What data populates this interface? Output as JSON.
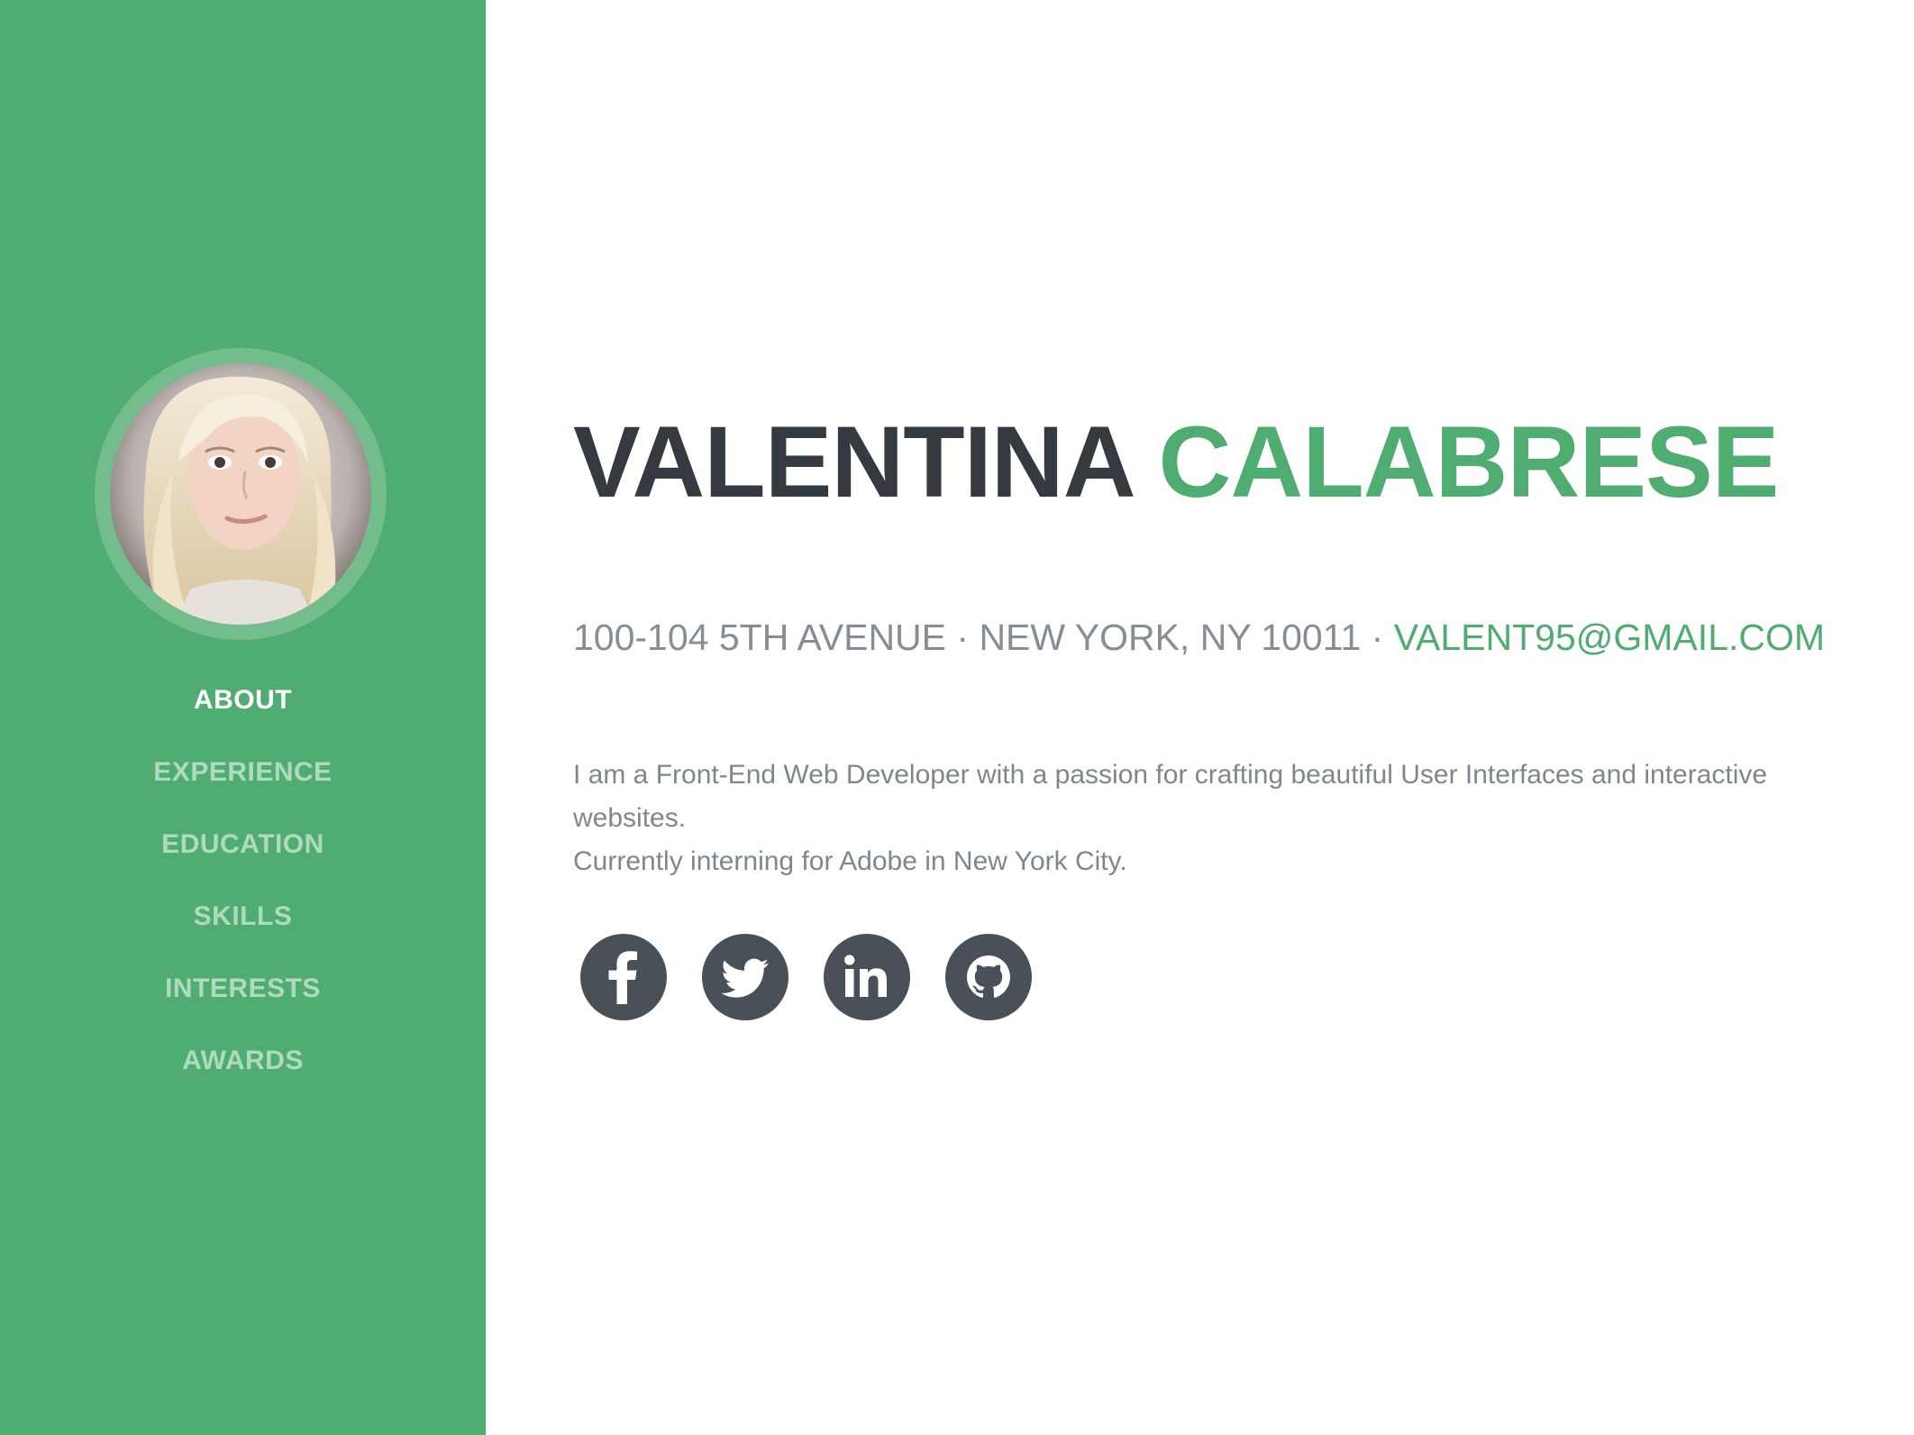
{
  "sidebar": {
    "background_color": "#50ad71",
    "avatar": {
      "icon": "profile-photo",
      "alt": "Valentina Calabrese"
    },
    "nav": [
      {
        "label": "ABOUT",
        "active": true
      },
      {
        "label": "EXPERIENCE",
        "active": false
      },
      {
        "label": "EDUCATION",
        "active": false
      },
      {
        "label": "SKILLS",
        "active": false
      },
      {
        "label": "INTERESTS",
        "active": false
      },
      {
        "label": "AWARDS",
        "active": false
      }
    ]
  },
  "main": {
    "first_name": "VALENTINA",
    "last_name": "CALABRESE",
    "address": "100-104 5TH AVENUE · NEW YORK, NY 10011 · ",
    "email": "VALENT95@GMAIL.COM",
    "bio_line1": "I am a Front-End Web Developer with a passion for crafting beautiful User Interfaces and interactive websites.",
    "bio_line2": "Currently interning for Adobe in New York City.",
    "socials": [
      {
        "icon": "facebook-icon"
      },
      {
        "icon": "twitter-icon"
      },
      {
        "icon": "linkedin-icon"
      },
      {
        "icon": "github-icon"
      }
    ]
  },
  "colors": {
    "accent": "#50ad71",
    "heading": "#343a40",
    "muted": "#858e96",
    "social_bg": "#495057"
  }
}
